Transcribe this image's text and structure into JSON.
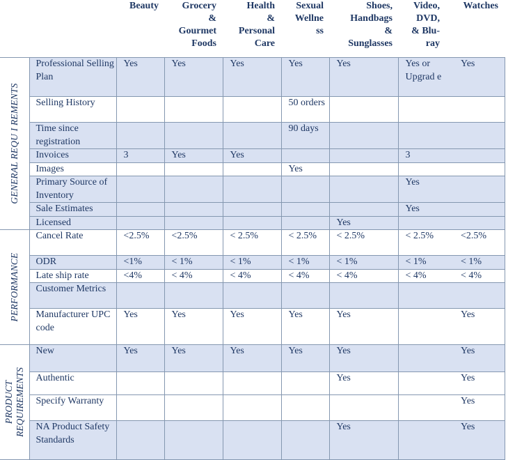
{
  "columns": [
    {
      "label": "Beauty"
    },
    {
      "label": "Grocery\n&\nGourmet\nFoods"
    },
    {
      "label": "Health\n&\nPersonal\nCare"
    },
    {
      "label": "Sexual\nWellne\nss"
    },
    {
      "label": "Shoes,\nHandbags\n&\nSunglasses"
    },
    {
      "label": "Video,\nDVD,\n& Blu-\nray"
    },
    {
      "label": "Watches"
    }
  ],
  "sections": [
    {
      "label": "GENERAL   REQU I REMENTS"
    },
    {
      "label": "PERFORMANCE"
    },
    {
      "label": "PRODUCT\nREQUIREMENTS"
    }
  ],
  "rows": [
    {
      "label": "Professional Selling Plan",
      "cells": [
        "Yes",
        "Yes",
        "Yes",
        "Yes",
        "Yes",
        "Yes or Upgrad e",
        "Yes"
      ]
    },
    {
      "label": "Selling History",
      "cells": [
        "",
        "",
        "",
        "50 orders",
        "",
        "",
        ""
      ]
    },
    {
      "label": "Time since registration",
      "cells": [
        "",
        "",
        "",
        "90 days",
        "",
        "",
        ""
      ]
    },
    {
      "label": "Invoices",
      "cells": [
        "3",
        "Yes",
        "Yes",
        "",
        "",
        "3",
        ""
      ]
    },
    {
      "label": "Images",
      "cells": [
        "",
        "",
        "",
        "Yes",
        "",
        "",
        ""
      ]
    },
    {
      "label": "Primary Source of Inventory",
      "cells": [
        "",
        "",
        "",
        "",
        "",
        "Yes",
        ""
      ]
    },
    {
      "label": "Sale Estimates",
      "cells": [
        "",
        "",
        "",
        "",
        "",
        "Yes",
        ""
      ]
    },
    {
      "label": "Licensed",
      "cells": [
        "",
        "",
        "",
        "",
        "Yes",
        "",
        ""
      ]
    },
    {
      "label": "Cancel Rate",
      "cells": [
        "<2.5%",
        "<2.5%",
        "< 2.5%",
        "< 2.5%",
        "< 2.5%",
        "< 2.5%",
        "<2.5%"
      ]
    },
    {
      "label": "ODR",
      "cells": [
        "<1%",
        "< 1%",
        "< 1%",
        "< 1%",
        "< 1%",
        "< 1%",
        "< 1%"
      ]
    },
    {
      "label": "Late ship rate",
      "cells": [
        "<4%",
        "< 4%",
        "< 4%",
        "< 4%",
        "< 4%",
        "< 4%",
        "< 4%"
      ]
    },
    {
      "label": "Customer Metrics",
      "cells": [
        "",
        "",
        "",
        "",
        "",
        "",
        ""
      ]
    },
    {
      "label": "Manufacturer UPC code",
      "cells": [
        "Yes",
        "Yes",
        "Yes",
        "Yes",
        "Yes",
        "",
        "Yes"
      ]
    },
    {
      "label": "New",
      "cells": [
        "Yes",
        "Yes",
        "Yes",
        "Yes",
        "Yes",
        "",
        "Yes"
      ]
    },
    {
      "label": "Authentic",
      "cells": [
        "",
        "",
        "",
        "",
        "Yes",
        "",
        "Yes"
      ]
    },
    {
      "label": "Specify Warranty",
      "cells": [
        "",
        "",
        "",
        "",
        "",
        "",
        "Yes"
      ]
    },
    {
      "label": "NA Product Safety Standards",
      "cells": [
        "",
        "",
        "",
        "",
        "Yes",
        "",
        "Yes"
      ]
    }
  ],
  "colors": {
    "text": "#1f3864",
    "shade": "#d9e1f2",
    "border": "#8497b0"
  }
}
